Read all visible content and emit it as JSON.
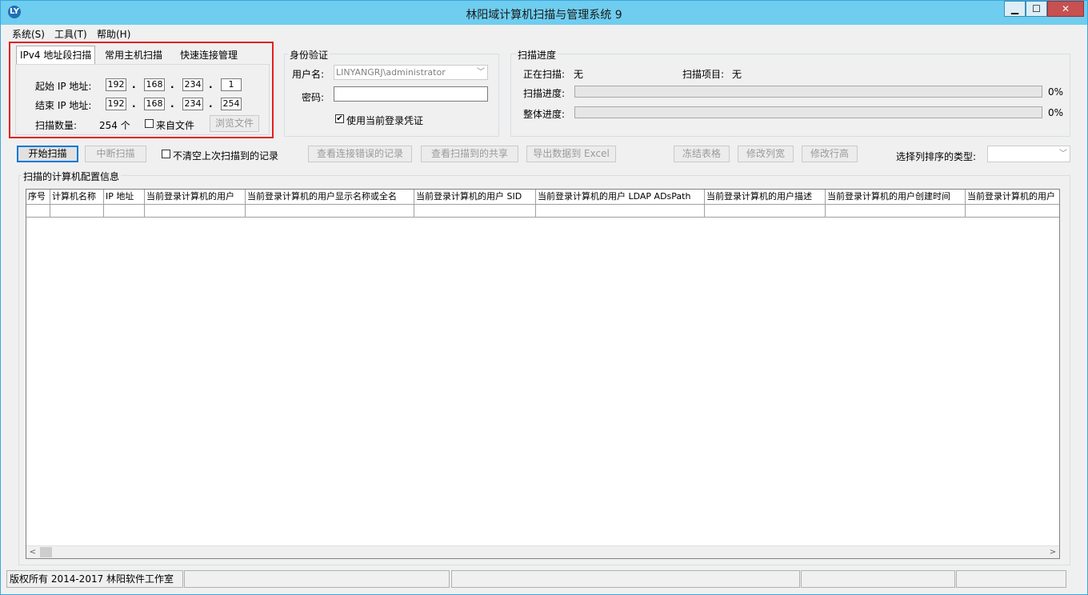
{
  "window": {
    "title": "林阳域计算机扫描与管理系统 9",
    "icon_text": "LY",
    "min_glyph": "▁",
    "max_glyph": "☐",
    "close_glyph": "✕"
  },
  "menu": [
    "系统(S)",
    "工具(T)",
    "帮助(H)"
  ],
  "tabs": [
    "IPv4 地址段扫描",
    "常用主机扫描",
    "快速连接管理"
  ],
  "ipv4": {
    "start_label": "起始 IP 地址:",
    "end_label": "结束 IP 地址:",
    "start_ip": [
      "192",
      "168",
      "234",
      "1"
    ],
    "end_ip": [
      "192",
      "168",
      "234",
      "254"
    ],
    "dot": ".",
    "count_label": "扫描数量:",
    "count_value": "254 个",
    "from_file_label": "来自文件",
    "browse_button": "浏览文件"
  },
  "auth": {
    "group_title": "身份验证",
    "username_label": "用户名:",
    "username_value": "LINYANGRJ\\administrator",
    "password_label": "密码:",
    "password_value": "",
    "use_current_label": "使用当前登录凭证",
    "use_current_checked": "✔"
  },
  "progress": {
    "group_title": "扫描进度",
    "scanning_label": "正在扫描:",
    "scanning_value": "无",
    "item_label": "扫描项目:",
    "item_value": "无",
    "scan_progress_label": "扫描进度:",
    "scan_progress_pct": "0%",
    "scan_progress_value": 0,
    "overall_label": "整体进度:",
    "overall_pct": "0%",
    "overall_value": 0
  },
  "toolbar": {
    "start": "开始扫描",
    "stop": "中断扫描",
    "keep_label": "不清空上次扫描到的记录",
    "view_errors": "查看连接错误的记录",
    "view_shares": "查看扫描到的共享",
    "export_excel": "导出数据到 Excel",
    "freeze": "冻结表格",
    "col_width": "修改列宽",
    "row_height": "修改行高",
    "sort_label": "选择列排序的类型:",
    "sort_value": ""
  },
  "grid": {
    "group_title": "扫描的计算机配置信息",
    "columns": [
      "序号",
      "计算机名称",
      "IP 地址",
      "当前登录计算机的用户",
      "当前登录计算机的用户显示名称或全名",
      "当前登录计算机的用户 SID",
      "当前登录计算机的用户 LDAP ADsPath",
      "当前登录计算机的用户描述",
      "当前登录计算机的用户创建时间",
      "当前登录计算机的用户"
    ],
    "scroll_left": "<",
    "scroll_right": ">"
  },
  "status": {
    "copyright": "版权所有 2014-2017 林阳软件工作室"
  },
  "colors": {
    "titlebar": "#6fcdef",
    "highlight_box": "#e41f1f",
    "close_button": "#c75050"
  }
}
